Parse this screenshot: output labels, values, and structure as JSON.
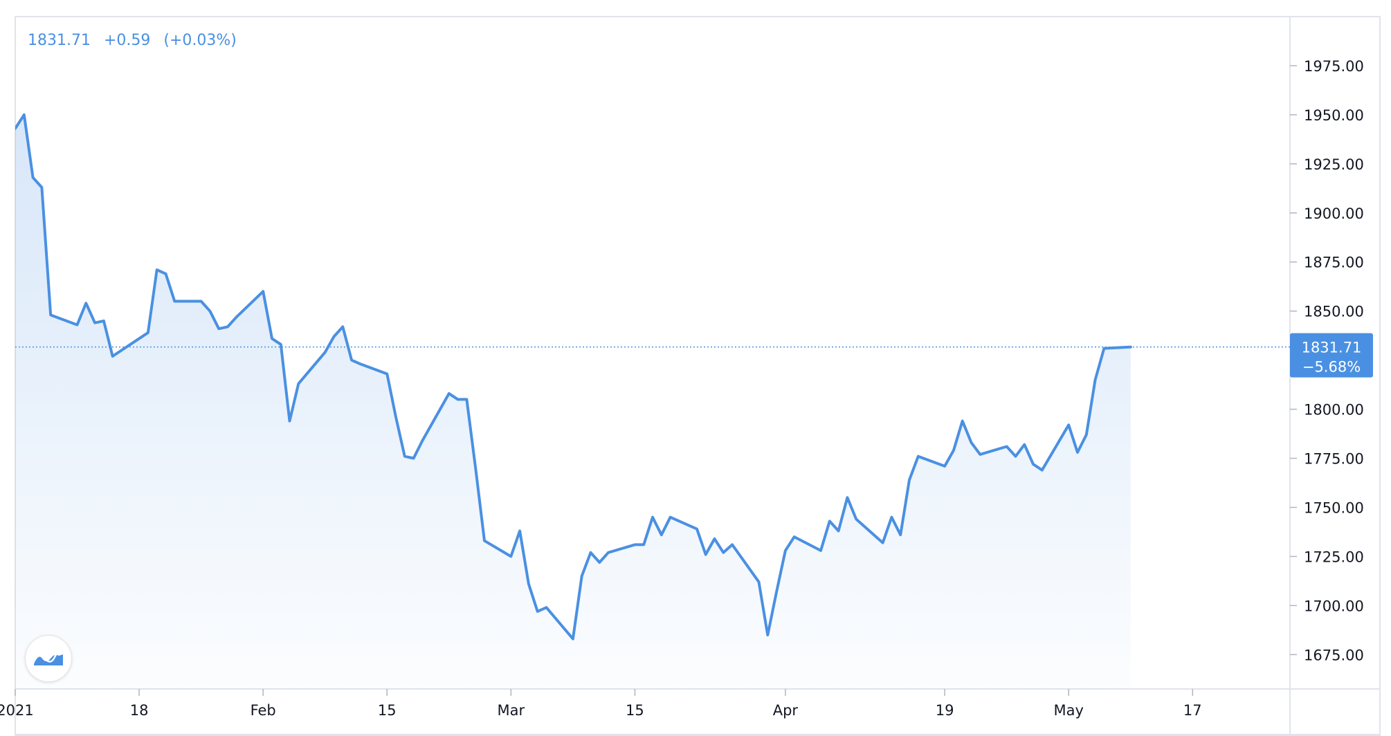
{
  "legend": {
    "price": "1831.71",
    "change": "+0.59",
    "change_pct": "(+0.03%)"
  },
  "price_tag": {
    "value": "1831.71",
    "change": "−5.68%"
  },
  "colors": {
    "line": "#4a90e2",
    "tag_bg": "#4a90e2",
    "grid_border": "#e0e3eb",
    "text": "#131722"
  },
  "icons": {
    "logo": "wave-chart-icon"
  },
  "chart_data": {
    "type": "area",
    "x": [
      "2021-01-04",
      "2021-01-05",
      "2021-01-06",
      "2021-01-07",
      "2021-01-08",
      "2021-01-11",
      "2021-01-12",
      "2021-01-13",
      "2021-01-14",
      "2021-01-15",
      "2021-01-18",
      "2021-01-19",
      "2021-01-20",
      "2021-01-21",
      "2021-01-22",
      "2021-01-25",
      "2021-01-26",
      "2021-01-27",
      "2021-01-28",
      "2021-01-29",
      "2021-02-01",
      "2021-02-02",
      "2021-02-03",
      "2021-02-04",
      "2021-02-05",
      "2021-02-08",
      "2021-02-09",
      "2021-02-10",
      "2021-02-11",
      "2021-02-12",
      "2021-02-15",
      "2021-02-16",
      "2021-02-17",
      "2021-02-18",
      "2021-02-19",
      "2021-02-22",
      "2021-02-23",
      "2021-02-24",
      "2021-02-25",
      "2021-02-26",
      "2021-03-01",
      "2021-03-02",
      "2021-03-03",
      "2021-03-04",
      "2021-03-05",
      "2021-03-08",
      "2021-03-09",
      "2021-03-10",
      "2021-03-11",
      "2021-03-12",
      "2021-03-15",
      "2021-03-16",
      "2021-03-17",
      "2021-03-18",
      "2021-03-19",
      "2021-03-22",
      "2021-03-23",
      "2021-03-24",
      "2021-03-25",
      "2021-03-26",
      "2021-03-29",
      "2021-03-30",
      "2021-03-31",
      "2021-04-01",
      "2021-04-02",
      "2021-04-05",
      "2021-04-06",
      "2021-04-07",
      "2021-04-08",
      "2021-04-09",
      "2021-04-12",
      "2021-04-13",
      "2021-04-14",
      "2021-04-15",
      "2021-04-16",
      "2021-04-19",
      "2021-04-20",
      "2021-04-21",
      "2021-04-22",
      "2021-04-23",
      "2021-04-26",
      "2021-04-27",
      "2021-04-28",
      "2021-04-29",
      "2021-04-30",
      "2021-05-03",
      "2021-05-04",
      "2021-05-05",
      "2021-05-06",
      "2021-05-07",
      "2021-05-10"
    ],
    "values": [
      1943,
      1950,
      1918,
      1913,
      1848,
      1843,
      1854,
      1844,
      1845,
      1827,
      1836,
      1839,
      1871,
      1869,
      1855,
      1855,
      1850,
      1841,
      1842,
      1847,
      1860,
      1836,
      1833,
      1794,
      1813,
      1829,
      1837,
      1842,
      1825,
      1823,
      1818,
      1796,
      1776,
      1775,
      1784,
      1808,
      1805,
      1805,
      1770,
      1733,
      1725,
      1738,
      1711,
      1697,
      1699,
      1683,
      1715,
      1727,
      1722,
      1727,
      1731,
      1731,
      1745,
      1736,
      1745,
      1739,
      1726,
      1734,
      1727,
      1731,
      1712,
      1685,
      1707,
      1728,
      1735,
      1728,
      1743,
      1738,
      1755,
      1744,
      1732,
      1745,
      1736,
      1764,
      1776,
      1771,
      1779,
      1794,
      1783,
      1777,
      1781,
      1776,
      1782,
      1772,
      1769,
      1792,
      1778,
      1787,
      1815,
      1831,
      1831.71
    ],
    "current_value": 1831.71,
    "x_ticks": [
      {
        "date": "2021-01-04",
        "label": "2021"
      },
      {
        "date": "2021-01-18",
        "label": "18"
      },
      {
        "date": "2021-02-01",
        "label": "Feb"
      },
      {
        "date": "2021-02-15",
        "label": "15"
      },
      {
        "date": "2021-03-01",
        "label": "Mar"
      },
      {
        "date": "2021-03-15",
        "label": "15"
      },
      {
        "date": "2021-04-01",
        "label": "Apr"
      },
      {
        "date": "2021-04-19",
        "label": "19"
      },
      {
        "date": "2021-05-03",
        "label": "May"
      },
      {
        "date": "2021-05-17",
        "label": "17"
      }
    ],
    "y_ticks": [
      1675,
      1700,
      1725,
      1750,
      1775,
      1800,
      1825,
      1850,
      1875,
      1900,
      1925,
      1950,
      1975
    ],
    "y_tick_labels": [
      "1675.00",
      "1700.00",
      "1725.00",
      "1750.00",
      "1775.00",
      "1800.00",
      "1825.00",
      "1850.00",
      "1875.00",
      "1900.00",
      "1925.00",
      "1950.00",
      "1975.00"
    ],
    "ylim": [
      1657.5,
      2000
    ],
    "xlim": [
      "2021-01-04",
      "2021-05-28"
    ],
    "y_axis_side": "right",
    "grid": false
  }
}
